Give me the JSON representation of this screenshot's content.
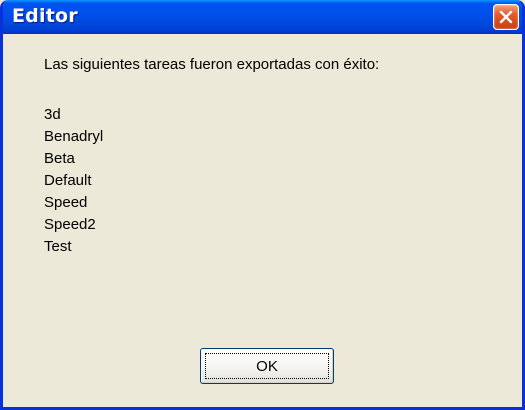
{
  "window": {
    "title": "Editor"
  },
  "titlebar": {
    "close_icon": "close-x-icon"
  },
  "dialog": {
    "message": "Las siguientes tareas fueron exportadas con éxito:",
    "tasks": [
      "3d",
      "Benadryl",
      "Beta",
      "Default",
      "Speed",
      "Speed2",
      "Test"
    ],
    "ok_label": "OK"
  },
  "colors": {
    "titlebar_blue": "#0053EE",
    "close_red": "#E35A2B",
    "dialog_bg": "#ECE9D8"
  }
}
